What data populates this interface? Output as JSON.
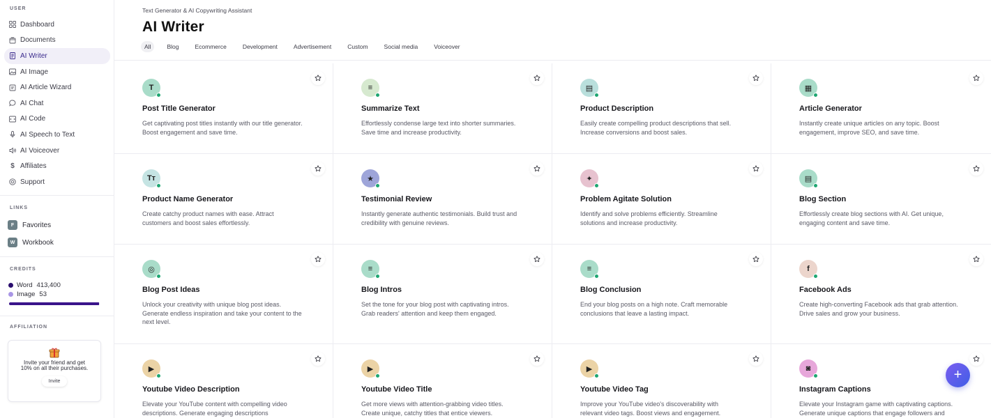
{
  "sidebar": {
    "user_title": "USER",
    "nav": [
      {
        "label": "Dashboard",
        "icon": "grid-icon"
      },
      {
        "label": "Documents",
        "icon": "document-icon"
      },
      {
        "label": "AI Writer",
        "icon": "writer-icon",
        "active": true
      },
      {
        "label": "AI Image",
        "icon": "image-icon"
      },
      {
        "label": "AI Article Wizard",
        "icon": "wizard-icon"
      },
      {
        "label": "AI Chat",
        "icon": "chat-icon"
      },
      {
        "label": "AI Code",
        "icon": "code-icon"
      },
      {
        "label": "AI Speech to Text",
        "icon": "microphone-icon"
      },
      {
        "label": "AI Voiceover",
        "icon": "speaker-icon"
      },
      {
        "label": "Affiliates",
        "icon": "dollar-icon"
      },
      {
        "label": "Support",
        "icon": "lifebuoy-icon"
      }
    ],
    "links_title": "LINKS",
    "links": [
      {
        "badge": "F",
        "label": "Favorites"
      },
      {
        "badge": "W",
        "label": "Workbook"
      }
    ],
    "credits_title": "CREDITS",
    "credits": [
      {
        "label": "Word",
        "value": "413,400",
        "color": "#2a0e6e"
      },
      {
        "label": "Image",
        "value": "53",
        "color": "#a996e6"
      }
    ],
    "credits_fill": 0.99,
    "affiliation_title": "AFFILIATION",
    "affiliation": {
      "text": "Invite your friend and get 10% on all their purchases.",
      "button": "Invite"
    }
  },
  "header": {
    "breadcrumb": "Text Generator & AI Copywriting Assistant",
    "title": "AI Writer",
    "tabs": [
      "All",
      "Blog",
      "Ecommerce",
      "Development",
      "Advertisement",
      "Custom",
      "Social media",
      "Voiceover"
    ],
    "active_tab": "All"
  },
  "cards": [
    {
      "title": "Post Title Generator",
      "desc": "Get captivating post titles instantly with our title generator. Boost engagement and save time.",
      "icon": "T",
      "bg": "#a9dcc9"
    },
    {
      "title": "Summarize Text",
      "desc": "Effortlessly condense large text into shorter summaries. Save time and increase productivity.",
      "icon": "≡",
      "bg": "#d6e9cf"
    },
    {
      "title": "Product Description",
      "desc": "Easily create compelling product descriptions that sell. Increase conversions and boost sales.",
      "icon": "▤",
      "bg": "#b9dfdc"
    },
    {
      "title": "Article Generator",
      "desc": "Instantly create unique articles on any topic. Boost engagement, improve SEO, and save time.",
      "icon": "▦",
      "bg": "#a9dcc9"
    },
    {
      "title": "Product Name Generator",
      "desc": "Create catchy product names with ease. Attract customers and boost sales effortlessly.",
      "icon": "Tт",
      "bg": "#c5e4e3"
    },
    {
      "title": "Testimonial Review",
      "desc": "Instantly generate authentic testimonials. Build trust and credibility with genuine reviews.",
      "icon": "★",
      "bg": "#9ea5d9"
    },
    {
      "title": "Problem Agitate Solution",
      "desc": "Identify and solve problems efficiently. Streamline solutions and increase productivity.",
      "icon": "✦",
      "bg": "#e7c2cf"
    },
    {
      "title": "Blog Section",
      "desc": "Effortlessly create blog sections with AI. Get unique, engaging content and save time.",
      "icon": "▤",
      "bg": "#a9dcc9"
    },
    {
      "title": "Blog Post Ideas",
      "desc": "Unlock your creativity with unique blog post ideas. Generate endless inspiration and take your content to the next level.",
      "icon": "◎",
      "bg": "#a9dcc9"
    },
    {
      "title": "Blog Intros",
      "desc": "Set the tone for your blog post with captivating intros. Grab readers' attention and keep them engaged.",
      "icon": "≡",
      "bg": "#a9dcc9"
    },
    {
      "title": "Blog Conclusion",
      "desc": "End your blog posts on a high note. Craft memorable conclusions that leave a lasting impact.",
      "icon": "≡",
      "bg": "#a9dcc9"
    },
    {
      "title": "Facebook Ads",
      "desc": "Create high-converting Facebook ads that grab attention. Drive sales and grow your business.",
      "icon": "f",
      "bg": "#ecd5cc"
    },
    {
      "title": "Youtube Video Description",
      "desc": "Elevate your YouTube content with compelling video descriptions. Generate engaging descriptions",
      "icon": "▶",
      "bg": "#ebd3a6"
    },
    {
      "title": "Youtube Video Title",
      "desc": "Get more views with attention-grabbing video titles. Create unique, catchy titles that entice viewers.",
      "icon": "▶",
      "bg": "#ebd3a6"
    },
    {
      "title": "Youtube Video Tag",
      "desc": "Improve your YouTube video's discoverability with relevant video tags. Boost views and engagement.",
      "icon": "▶",
      "bg": "#ebd3a6"
    },
    {
      "title": "Instagram Captions",
      "desc": "Elevate your Instagram game with captivating captions. Generate unique captions that engage followers and",
      "icon": "◙",
      "bg": "#e7a7da"
    }
  ],
  "fab": {
    "label": "+",
    "icon": "plus-icon"
  }
}
